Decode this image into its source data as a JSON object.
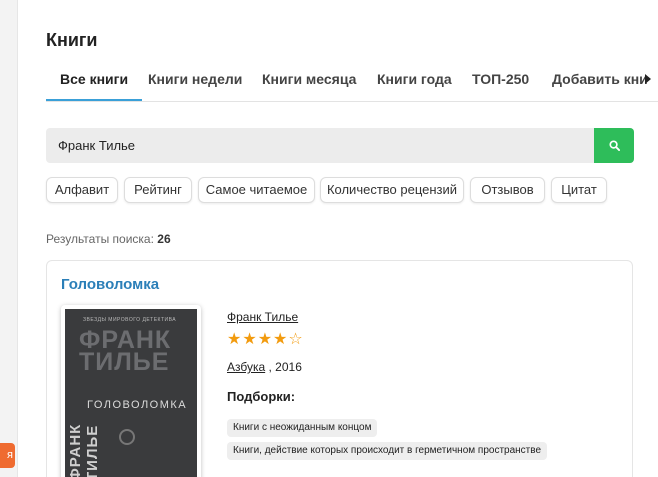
{
  "page": {
    "title": "Книги"
  },
  "tabs": [
    {
      "label": "Все книги",
      "active": true
    },
    {
      "label": "Книги недели"
    },
    {
      "label": "Книги месяца"
    },
    {
      "label": "Книги года"
    },
    {
      "label": "ТОП-250"
    },
    {
      "label": "Добавить кни"
    }
  ],
  "tab_arrow_icon": "chevron-right-icon",
  "search": {
    "value": "Франк Тилье",
    "button_icon": "search-icon",
    "button_color": "#2ebd5a"
  },
  "filters": [
    "Алфавит",
    "Рейтинг",
    "Самое читаемое",
    "Количество рецензий",
    "Отзывов",
    "Цитат"
  ],
  "results": {
    "label": "Результаты поиска:",
    "count": "26"
  },
  "book": {
    "title": "Головоломка",
    "author": "Франк Тилье",
    "rating_stars": 4,
    "rating_max": 5,
    "stars_text": "★★★★☆",
    "publisher": "Азбука",
    "year": ", 2016",
    "collections_label": "Подборки:",
    "collections": [
      "Книги с неожиданным концом",
      "Книги, действие которых происходит в герметичном пространстве"
    ],
    "cover": {
      "top_text": "ЗВЕЗДЫ МИРОВОГО ДЕТЕКТИВА",
      "author_line1": "ФРАНК",
      "author_line2": "ТИЛЬЕ",
      "side_text": "ФРАНК ТИЛЬЕ",
      "name": "ГОЛОВОЛОМКА"
    }
  },
  "side_badge": {
    "text": "я",
    "color": "#ef6b30"
  },
  "accent_color": "#2b7fb8"
}
